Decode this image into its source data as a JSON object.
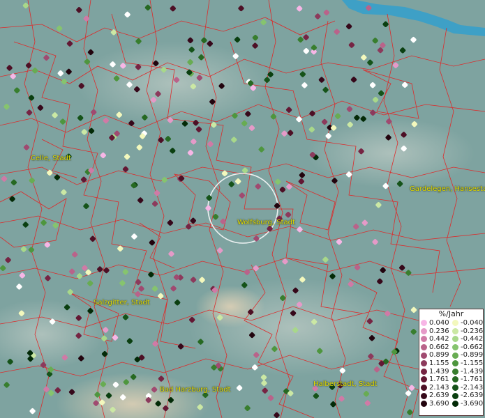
{
  "legend": {
    "title": "%/Jahr",
    "positive": [
      {
        "label": "0.040",
        "color": "#f7b6e6"
      },
      {
        "label": "0.236",
        "color": "#e59ac8"
      },
      {
        "label": "0.442",
        "color": "#d07aa6"
      },
      {
        "label": "0.662",
        "color": "#b9638a"
      },
      {
        "label": "0.899",
        "color": "#a04a70"
      },
      {
        "label": "1.155",
        "color": "#8c3a5c"
      },
      {
        "label": "1.439",
        "color": "#762443"
      },
      {
        "label": "1.761",
        "color": "#631733"
      },
      {
        "label": "2.143",
        "color": "#4d0f25"
      },
      {
        "label": "2.639",
        "color": "#36081a"
      },
      {
        "label": "3.690",
        "color": "#22040e"
      }
    ],
    "negative": [
      {
        "label": "-0.040",
        "color": "#f3f8bd"
      },
      {
        "label": "-0.236",
        "color": "#cbe8a4"
      },
      {
        "label": "-0.442",
        "color": "#a8d88a"
      },
      {
        "label": "-0.662",
        "color": "#86c46e"
      },
      {
        "label": "-0.899",
        "color": "#68ac52"
      },
      {
        "label": "-1.155",
        "color": "#4e963e"
      },
      {
        "label": "-1.439",
        "color": "#387e2e"
      },
      {
        "label": "-1.761",
        "color": "#266922"
      },
      {
        "label": "-2.143",
        "color": "#155319"
      },
      {
        "label": "-2.639",
        "color": "#0a3f10"
      },
      {
        "label": "-3.690",
        "color": "#032a07"
      }
    ]
  },
  "cities": [
    {
      "name": "Celle, Stadt"
    },
    {
      "name": "Gardelegen, Hansestadt"
    },
    {
      "name": "Wolfsburg, Stadt"
    },
    {
      "name": "Salzgitter, Stadt"
    },
    {
      "name": "Bad Harzburg, Stadt"
    },
    {
      "name": "Halberstadt, Stadt"
    }
  ],
  "colors": {
    "background": "#7ea3a0",
    "borders": "#dd2a2a",
    "water": "#2e9fd0",
    "white_point": "#ffffff"
  }
}
